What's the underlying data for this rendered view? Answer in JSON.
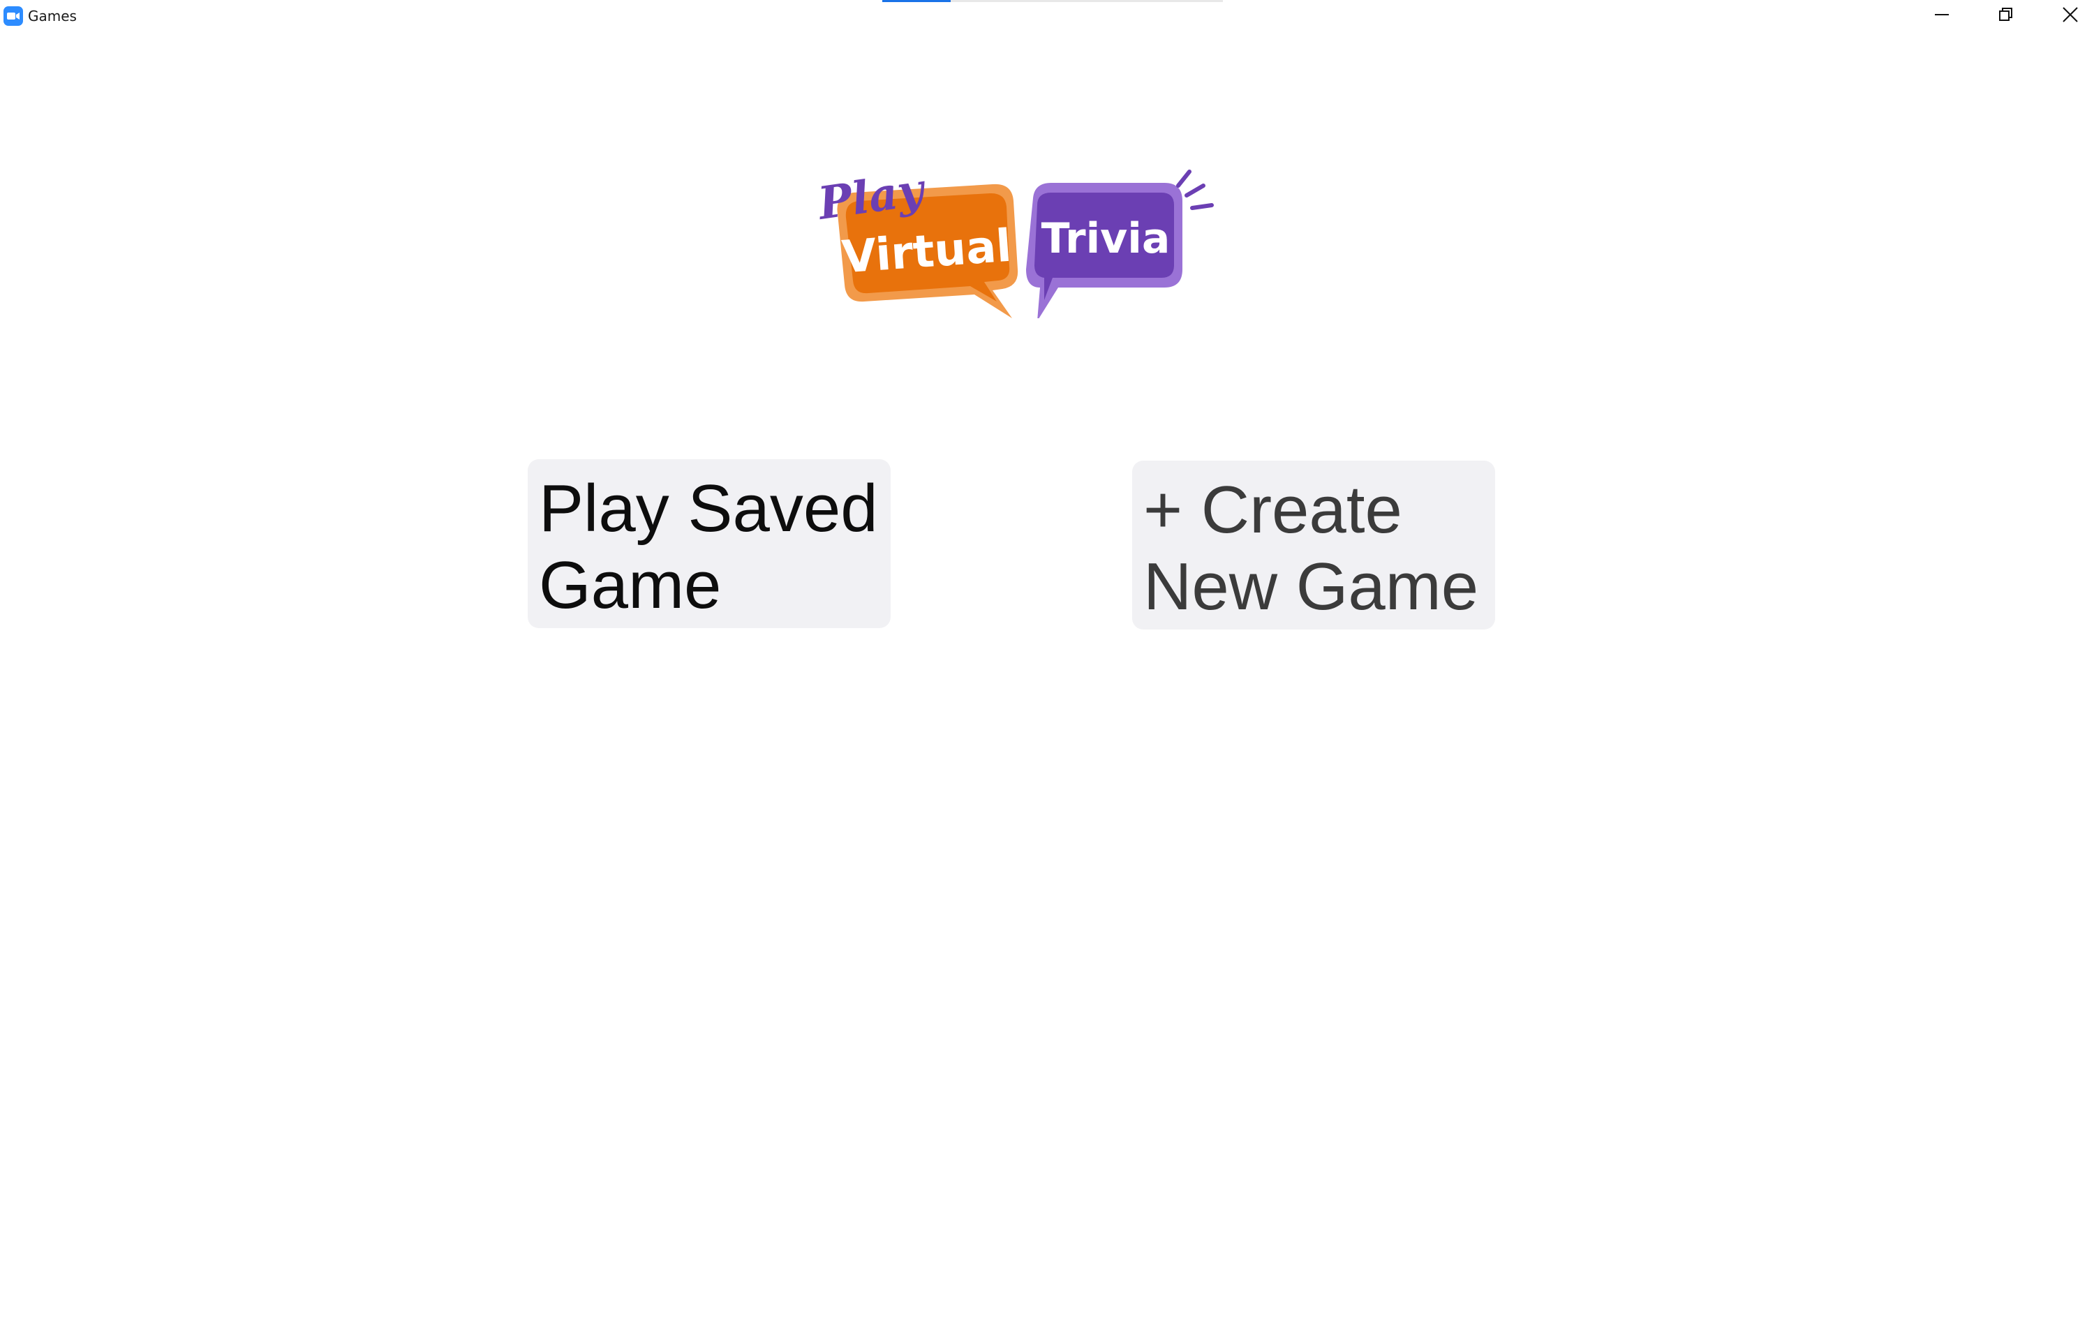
{
  "window": {
    "title": "Games",
    "app_icon": "zoom-camera-icon",
    "controls": {
      "minimize": "minimize-icon",
      "restore": "restore-icon",
      "close": "close-icon"
    },
    "loading_progress": 0.2
  },
  "logo": {
    "word_play": "Play",
    "word_virtual": "Virtual",
    "word_trivia": "Trivia",
    "colors": {
      "purple": "#6b3fb3",
      "orange": "#e8720c",
      "orange_border": "#f29a4a",
      "purple_border": "#9a72d6"
    }
  },
  "actions": {
    "play_saved": {
      "line1": "Play Saved",
      "line2": "Game"
    },
    "create_new": {
      "line1": "+ Create",
      "line2": "New Game"
    }
  },
  "colors": {
    "background": "#ffffff",
    "button_background": "#f1f1f4",
    "accent": "#1a73e8"
  }
}
